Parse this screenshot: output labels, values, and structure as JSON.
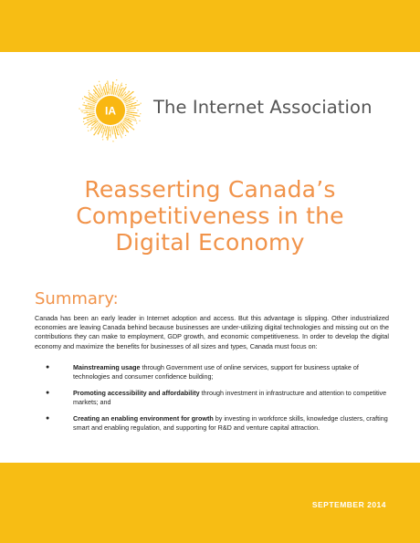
{
  "header": {
    "logo_mark": "IA",
    "org_name": "The Internet Association"
  },
  "title_lines": [
    "Reasserting Canada’s",
    "Competitiveness in the",
    "Digital Economy"
  ],
  "summary": {
    "heading": "Summary:",
    "paragraph": "Canada has been an early leader in Internet adoption and access. But this advantage is slipping.  Other industrialized economies are leaving Canada behind because businesses are under-utilizing digital technologies and missing out on the contributions they can make to employment, GDP growth, and economic competitiveness.  In order to develop the digital economy and maximize the benefits for businesses of all sizes and types, Canada must focus on:",
    "bullets": [
      {
        "bold": "Mainstreaming usage",
        "text": " through Government use of online services, support for business uptake of technologies and consumer confidence building;"
      },
      {
        "bold": "Promoting accessibility and affordability",
        "text": " through investment in infrastructure and attention to competitive markets; and"
      },
      {
        "bold": "Creating an enabling environment for growth",
        "text": " by investing in workforce skills, knowledge clusters, crafting smart and enabling regulation, and supporting for R&D and venture capital attraction."
      }
    ]
  },
  "footer": {
    "date": "SEPTEMBER 2014"
  },
  "colors": {
    "band": "#f7bd14",
    "accent_orange": "#f1934a",
    "logo_yellow": "#f9b712"
  }
}
